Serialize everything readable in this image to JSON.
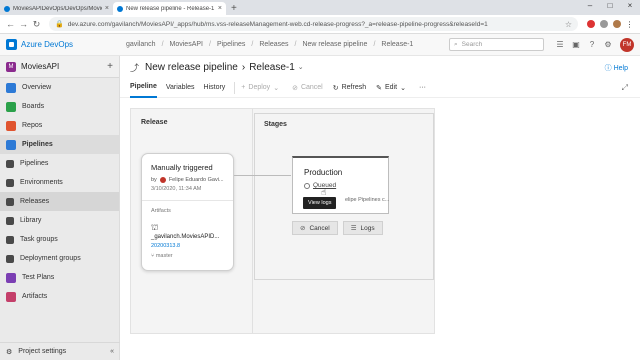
{
  "browser": {
    "tabs": [
      {
        "title": "MoviesAPIDevOps/DevOps/MoviesAPI.Te",
        "active": false
      },
      {
        "title": "New release pipeline - Release-1 - A",
        "active": true
      }
    ],
    "url": "dev.azure.com/gavilanch/MoviesAPI/_apps/hub/ms.vss-releaseManagement-web.cd-release-progress?_a=release-pipeline-progress&releaseId=1"
  },
  "header": {
    "app_name": "Azure DevOps",
    "breadcrumbs": [
      "gavilanch",
      "MoviesAPI",
      "Pipelines",
      "Releases",
      "New release pipeline",
      "Release-1"
    ],
    "search_placeholder": "Search",
    "avatar_initials": "FM"
  },
  "sidebar": {
    "project": {
      "badge": "M",
      "name": "MoviesAPI"
    },
    "items": [
      {
        "label": "Overview",
        "color": "#2d7ad6"
      },
      {
        "label": "Boards",
        "color": "#2ba14a"
      },
      {
        "label": "Repos",
        "color": "#e0542f"
      },
      {
        "label": "Pipelines",
        "color": "#2d7ad6"
      },
      {
        "label": "Pipelines",
        "color": "#4a4a4a"
      },
      {
        "label": "Environments",
        "color": "#4a4a4a"
      },
      {
        "label": "Releases",
        "color": "#4a4a4a"
      },
      {
        "label": "Library",
        "color": "#4a4a4a"
      },
      {
        "label": "Task groups",
        "color": "#4a4a4a"
      },
      {
        "label": "Deployment groups",
        "color": "#4a4a4a"
      },
      {
        "label": "Test Plans",
        "color": "#7b3fb3"
      },
      {
        "label": "Artifacts",
        "color": "#c43f6a"
      }
    ],
    "footer": "Project settings"
  },
  "main": {
    "title": "New release pipeline",
    "release": "Release-1",
    "help": "Help",
    "tabs": [
      "Pipeline",
      "Variables",
      "History"
    ],
    "actions": {
      "deploy": "Deploy",
      "cancel": "Cancel",
      "refresh": "Refresh",
      "edit": "Edit"
    },
    "release_section": "Release",
    "stages_section": "Stages",
    "artifact_card": {
      "trigger": "Manually triggered",
      "by_prefix": "by",
      "by_name": "Felipe Eduardo Gavi...",
      "when": "3/10/2020, 11:34 AM",
      "artifacts_label": "Artifacts",
      "artifact_name": "_gavilanch.MoviesAPID...",
      "version": "20200313.8",
      "branch": "master"
    },
    "stage": {
      "name": "Production",
      "status": "Queued",
      "subtext": "elipe Pipelines c...",
      "tooltip": "View logs",
      "cancel": "Cancel",
      "logs": "Logs"
    }
  }
}
